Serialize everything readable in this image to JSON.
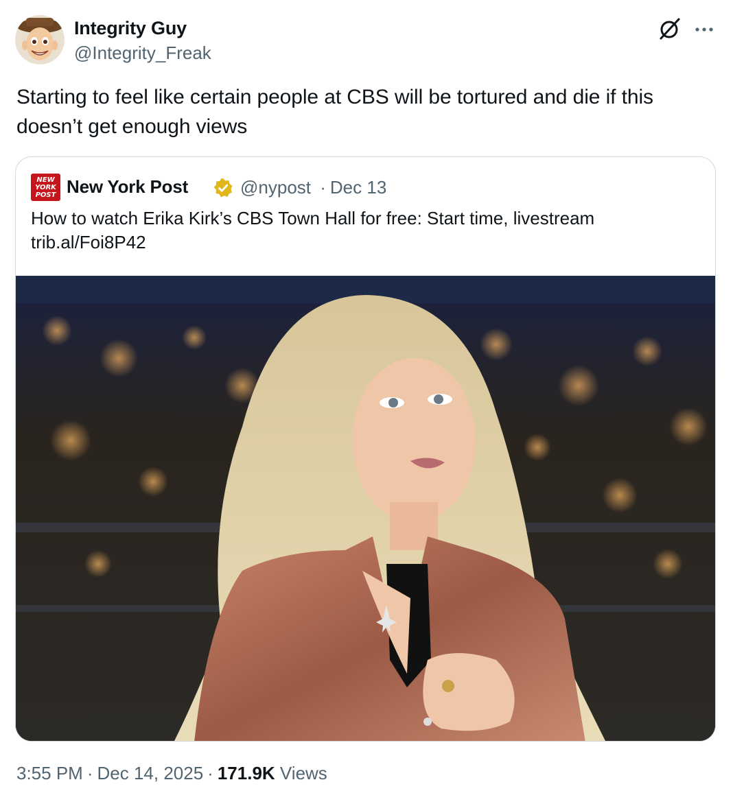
{
  "post": {
    "author_name": "Integrity Guy",
    "author_handle": "@Integrity_Freak",
    "text": "Starting to feel like certain people at CBS will be tortured and die if this doesn’t get enough views",
    "time": "3:55 PM",
    "date": "Dec 14, 2025",
    "views_count": "171.9K",
    "views_label": "Views",
    "separator": "·"
  },
  "quote": {
    "logo_lines": [
      "NEW",
      "YORK",
      "POST"
    ],
    "author_name": "New York Post",
    "author_handle": "@nypost",
    "separator": "·",
    "date": "Dec 13",
    "text": "How to watch Erika Kirk’s CBS Town Hall for free: Start time, livestream",
    "link": "trib.al/Foi8P42"
  },
  "icons": {
    "grok": "grok-icon",
    "more": "more-icon",
    "verified": "verified-badge-icon"
  },
  "colors": {
    "text_primary": "#0f1419",
    "text_secondary": "#536471",
    "border": "#cfd9de",
    "verified_gold": "#e2b719",
    "nypost_red": "#c4161c"
  }
}
